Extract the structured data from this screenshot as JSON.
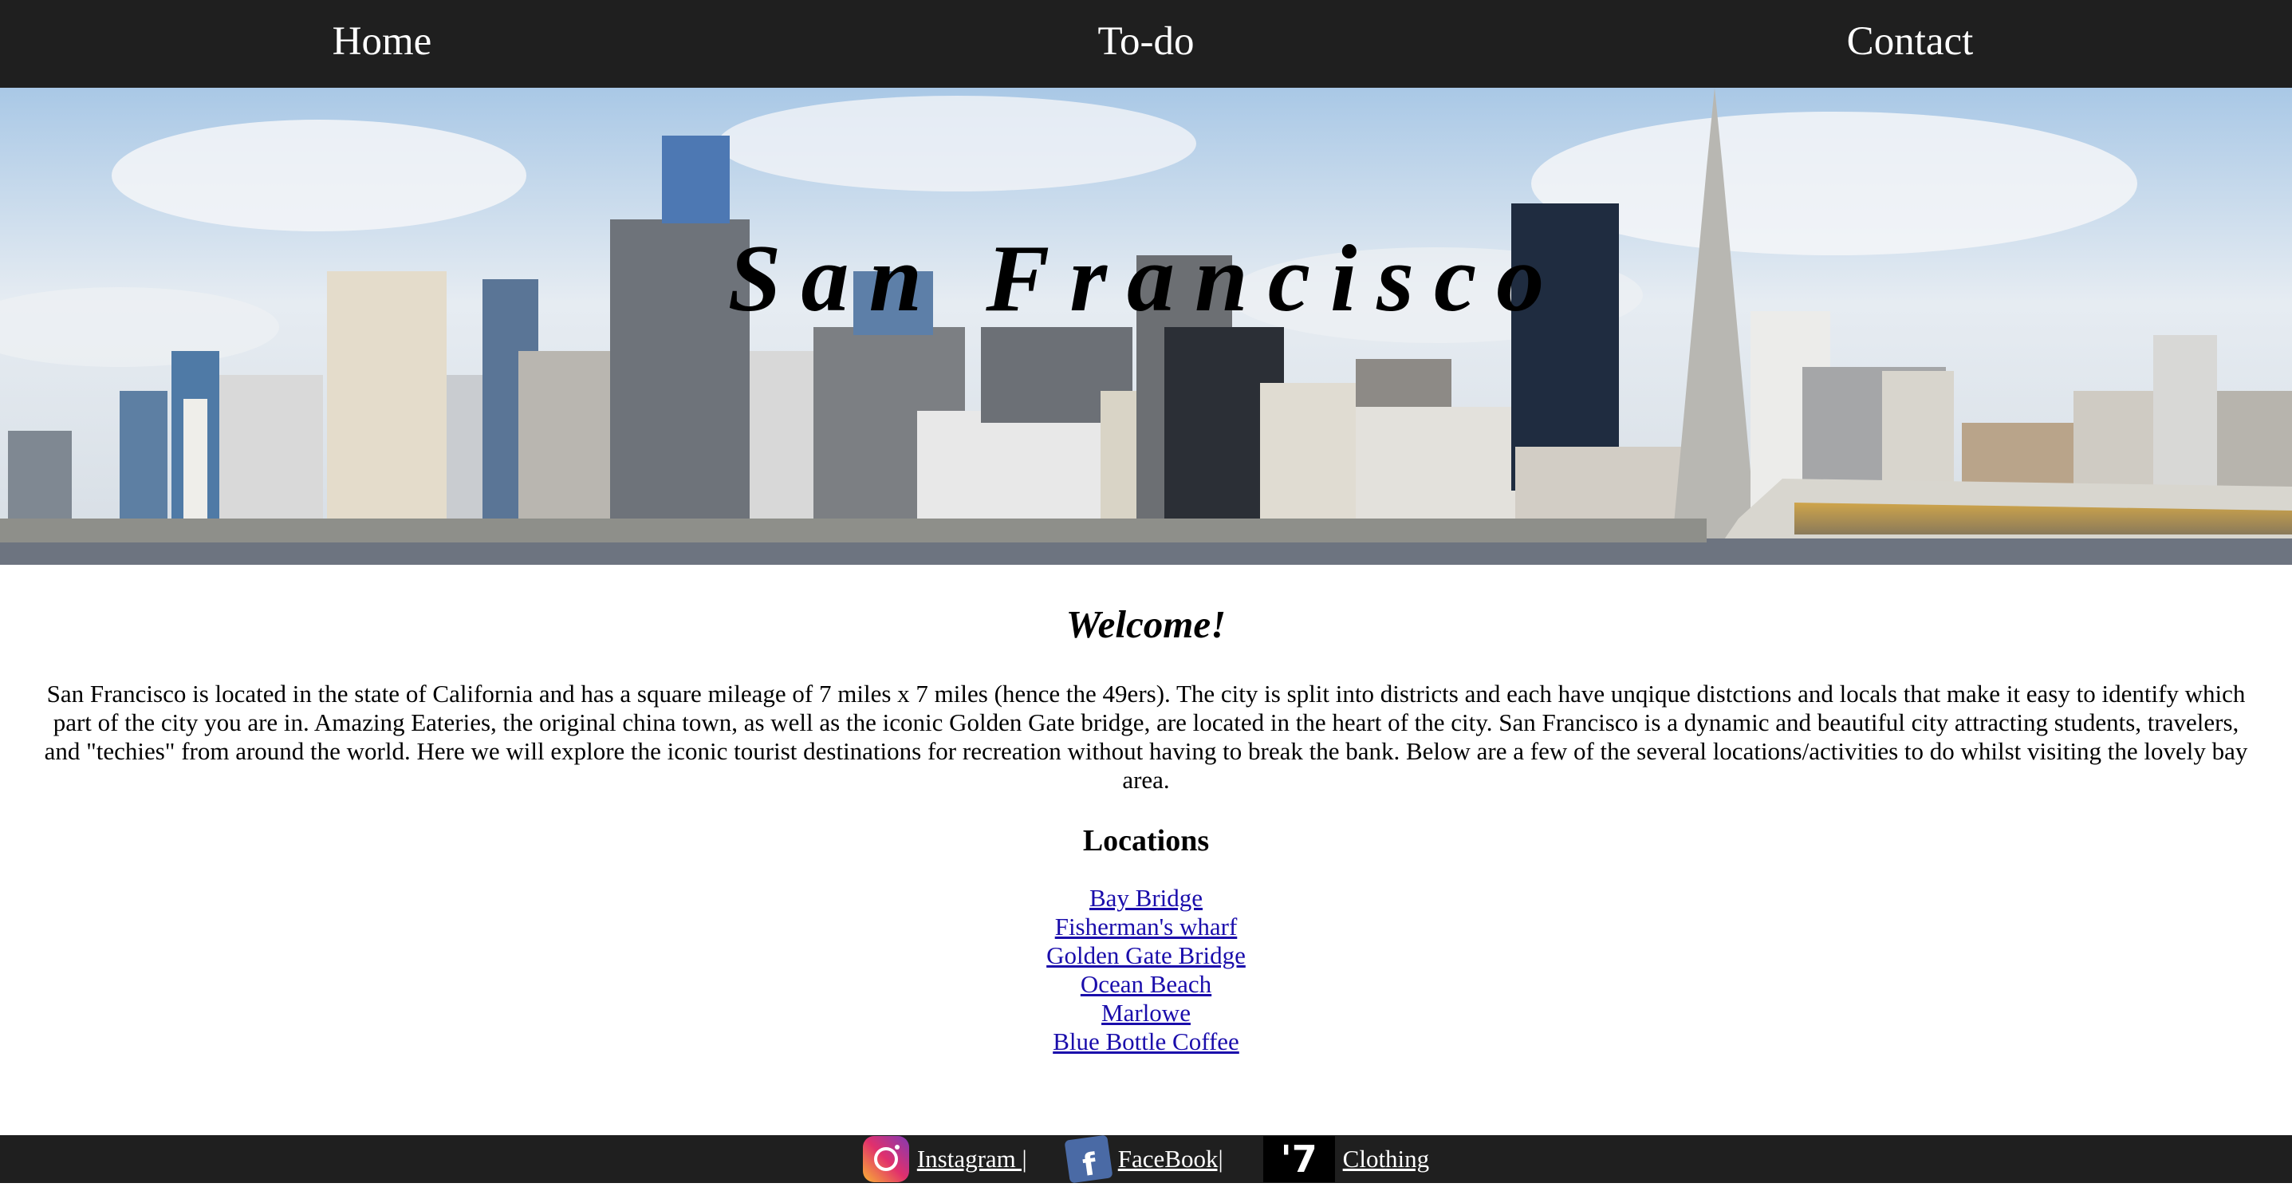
{
  "nav": {
    "items": [
      {
        "label": "Home"
      },
      {
        "label": "To-do"
      },
      {
        "label": "Contact"
      }
    ]
  },
  "hero": {
    "title": "San Francisco"
  },
  "main": {
    "welcome": "Welcome!",
    "intro": "San Francisco is located in the state of California and has a square mileage of 7 miles x 7 miles (hence the 49ers). The city is split into districts and each have unqique distctions and locals that make it easy to identify which part of the city you are in. Amazing Eateries, the original china town, as well as the iconic Golden Gate bridge, are located in the heart of the city. San Francisco is a dynamic and beautiful city attracting students, travelers, and \"techies\" from around the world. Here we will explore the iconic tourist destinations for recreation without having to break the bank. Below are a few of the several locations/activities to do whilst visiting the lovely bay area.",
    "locations_heading": "Locations",
    "locations": [
      {
        "label": "Bay Bridge"
      },
      {
        "label": "Fisherman's wharf"
      },
      {
        "label": "Golden Gate Bridge"
      },
      {
        "label": "Ocean Beach"
      },
      {
        "label": "Marlowe"
      },
      {
        "label": "Blue Bottle Coffee"
      }
    ]
  },
  "footer": {
    "instagram": {
      "label": "Instagram |",
      "icon": "instagram-icon"
    },
    "facebook": {
      "label": "FaceBook|",
      "icon": "facebook-icon"
    },
    "clothing": {
      "label": "Clothing",
      "icon": "clothing-logo-icon",
      "logo_text": "'7"
    }
  },
  "colors": {
    "nav_bg": "#1f1f1f",
    "link": "#1a0dab"
  }
}
